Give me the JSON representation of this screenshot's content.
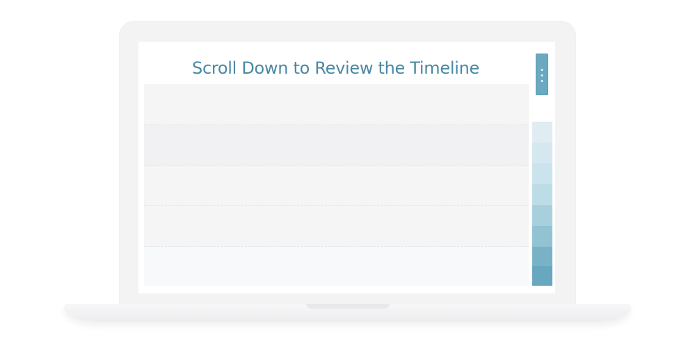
{
  "timeline": {
    "title": "Scroll Down to Review the Timeline"
  },
  "colors": {
    "title": "#4a88a3",
    "rows": [
      "#f5f5f5",
      "#f1f1f3",
      "#f5f5f5",
      "#f5f5f5",
      "#f7f9fb"
    ],
    "rail": [
      "#ffffff",
      "#dfedf2",
      "#d5e8ef",
      "#cbe3ec",
      "#bcdde6",
      "#a7d0dc",
      "#91c3d2",
      "#79b2c6",
      "#67a7bf"
    ],
    "thumb": "#6ba9c1"
  },
  "icons": {
    "thumb_grip": "vertical-dots-icon"
  }
}
